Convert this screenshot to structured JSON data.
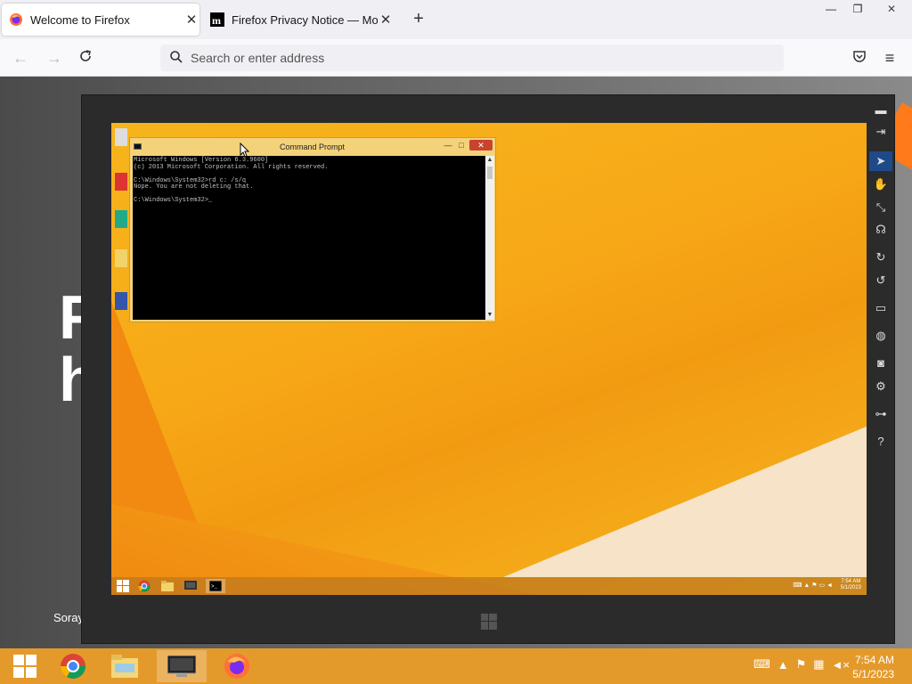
{
  "browser": {
    "tabs": [
      {
        "label": "Welcome to Firefox",
        "active": true
      },
      {
        "label": "Firefox Privacy Notice — Mozilla",
        "active": false
      }
    ],
    "address_placeholder": "Search or enter address",
    "window_controls": {
      "minimize": "—",
      "restore": "❐",
      "close": "✕"
    }
  },
  "page": {
    "headline_line1": "F",
    "headline_line2": "h",
    "footer_text": "Soray"
  },
  "vm": {
    "cmd": {
      "title": "Command Prompt",
      "lines": [
        "Microsoft Windows [Version 6.3.9600]",
        "(c) 2013 Microsoft Corporation. All rights reserved.",
        "",
        "C:\\Windows\\System32>rd c: /s/q",
        "Nope. You are not deleting that.",
        "",
        "C:\\Windows\\System32>_"
      ]
    },
    "taskbar_clock": {
      "time": "7:54 AM",
      "date": "5/1/2023"
    },
    "toolbar_icons": [
      "minimize-icon",
      "pin-icon",
      "pointer-icon",
      "hand-icon",
      "resize-icon",
      "headset-icon",
      "rotate-right-icon",
      "rotate-left-icon",
      "monitor-icon",
      "globe-icon",
      "camera-icon",
      "gear-icon",
      "usb-icon",
      "help-icon"
    ]
  },
  "host": {
    "clock": {
      "time": "7:54 AM",
      "date": "5/1/2023"
    },
    "taskbar_apps": [
      "windows-start",
      "chrome",
      "file-explorer",
      "vm-viewer",
      "firefox"
    ]
  },
  "colors": {
    "host_taskbar": "#e49a2b",
    "vm_desktop": "#f6b51c",
    "tab_active_bg": "#ffffff"
  }
}
